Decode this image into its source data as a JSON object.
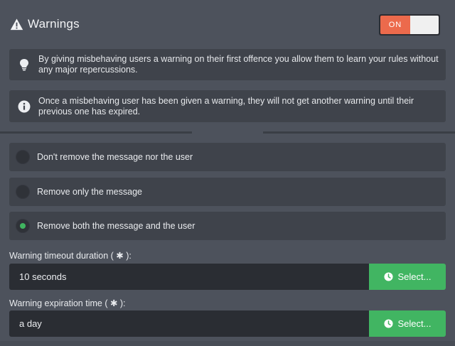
{
  "header": {
    "title": "Warnings",
    "toggle_on_label": "ON",
    "toggle_state": "on"
  },
  "info": {
    "tip": "By giving misbehaving users a warning on their first offence you allow them to learn your rules without any major repercussions.",
    "note": "Once a misbehaving user has been given a warning, they will not get another warning until their previous one has expired."
  },
  "options": [
    {
      "label": "Don't remove the message nor the user",
      "selected": false
    },
    {
      "label": "Remove only the message",
      "selected": false
    },
    {
      "label": "Remove both the message and the user",
      "selected": true
    }
  ],
  "fields": {
    "timeout_label": "Warning timeout duration ( ✱ ):",
    "timeout_value": "10 seconds",
    "expiration_label": "Warning expiration time ( ✱ ):",
    "expiration_value": "a day",
    "select_label": "Select..."
  },
  "colors": {
    "background": "#4d525c",
    "box": "#3f434b",
    "accent_on": "#ec6a4c",
    "select_green": "#41b562"
  },
  "icons": {
    "title": "warning-triangle-icon",
    "tip": "lightbulb-icon",
    "note": "info-icon",
    "select": "clock-icon"
  }
}
